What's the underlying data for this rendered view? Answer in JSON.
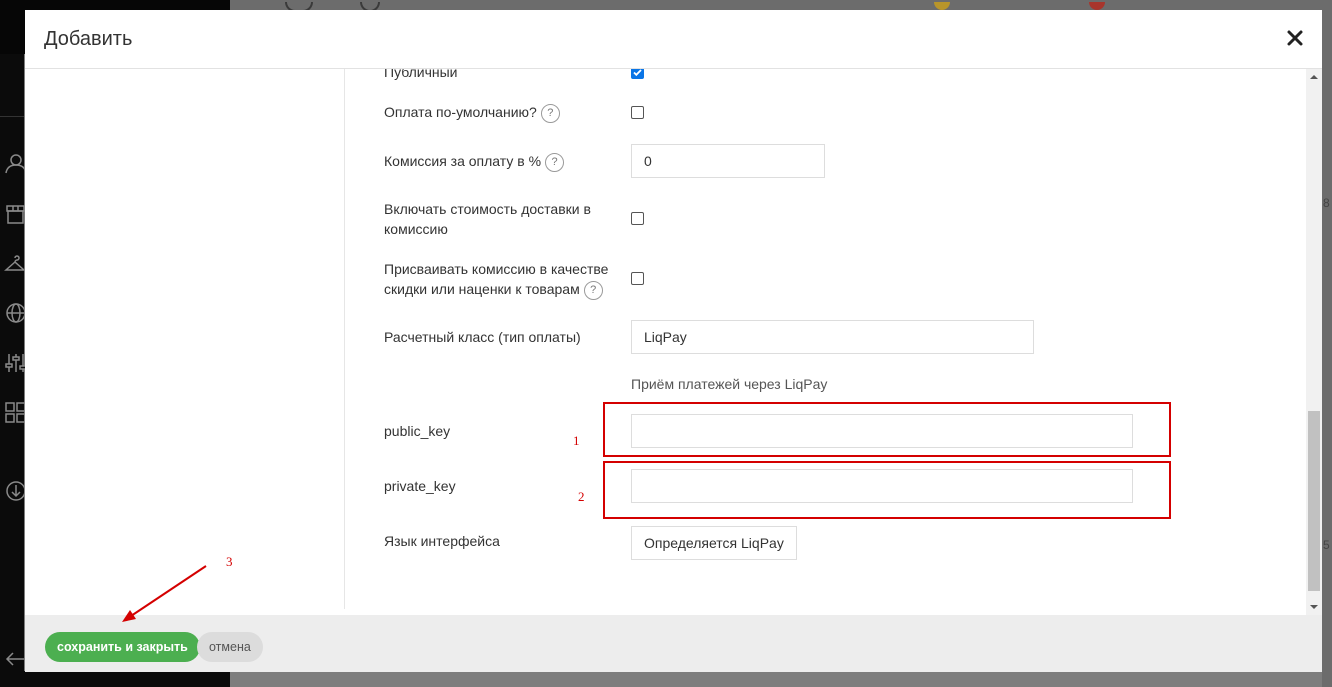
{
  "modal": {
    "title": "Добавить",
    "close_label": "×"
  },
  "form": {
    "public_label": "Публичный",
    "default_payment_label": "Оплата по-умолчанию?",
    "commission_label": "Комиссия за оплату в %",
    "commission_value": "0",
    "include_delivery_label_line1": "Включать стоимость доставки в",
    "include_delivery_label_line2": "комиссию",
    "assign_commission_label_line1": "Присваивать комиссию в качестве",
    "assign_commission_label_line2": "скидки или наценки к товарам",
    "calc_class_label": "Расчетный класс (тип оплаты)",
    "calc_class_value": "LiqPay",
    "liqpay_hint": "Приём платежей через LiqPay",
    "public_key_label": "public_key",
    "public_key_value": "",
    "private_key_label": "private_key",
    "private_key_value": "",
    "interface_lang_label": "Язык интерфейса",
    "interface_lang_value": "Определяется LiqPay",
    "help_glyph": "?"
  },
  "checkboxes": {
    "public": true,
    "default_payment": false,
    "include_delivery": false,
    "assign_commission": false
  },
  "footer": {
    "save_label": "сохранить и закрыть",
    "cancel_label": "отмена"
  },
  "annotations": {
    "n1": "1",
    "n2": "2",
    "n3": "3",
    "color": "#d40000"
  },
  "colors": {
    "save_button": "#4caf50",
    "checkbox_checked": "#0a75e6"
  },
  "background": {
    "right_glyph_1": "8",
    "right_glyph_2": "5"
  }
}
